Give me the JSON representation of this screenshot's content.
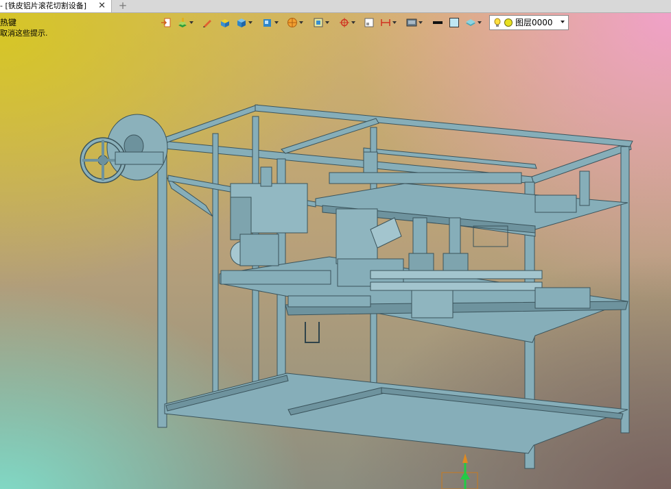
{
  "tab": {
    "title": "- [铁皮铝片滚花切割设备]",
    "close_glyph": "✕",
    "new_glyph": "+"
  },
  "hints": {
    "line1": "热键",
    "line2": "取消这些提示."
  },
  "toolbar": {
    "layer_name": "图层0000",
    "icons": [
      "import-icon",
      "layer-paint-icon",
      "pencil-icon",
      "face-box-icon",
      "solid-box-icon",
      "view-box-icon",
      "ball-icon",
      "render-icon",
      "snap-icon",
      "grid-icon",
      "dimension-icon",
      "display-icon",
      "line-color-icon",
      "fill-color-icon",
      "layer-stack-icon"
    ]
  },
  "colors": {
    "frame": "#7fa7b3",
    "frame_dark": "#3f5860",
    "axis_up": "#22cc44",
    "axis_tip": "#e08a20"
  }
}
